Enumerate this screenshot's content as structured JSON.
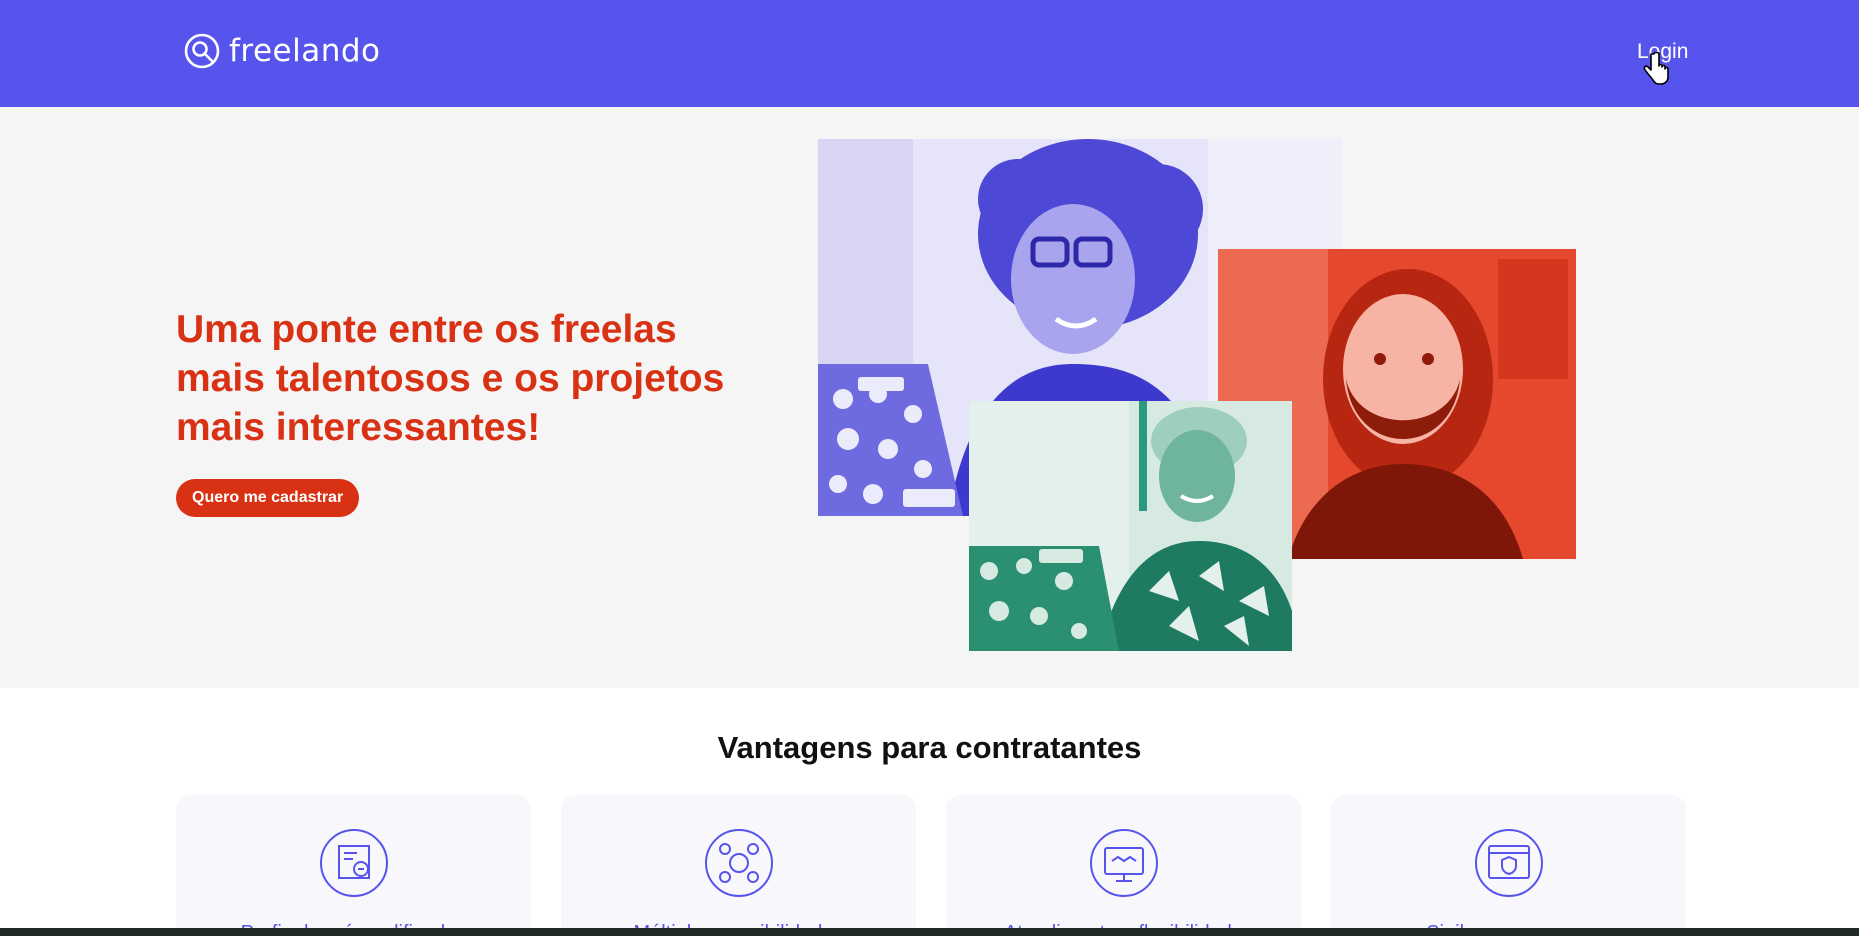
{
  "header": {
    "logo_text": "freelando",
    "login_label": "Login",
    "brand_color": "#5754ED"
  },
  "hero": {
    "title": "Uma ponte entre os freelas mais talentosos e os projetos mais interessantes!",
    "cta_label": "Quero me cadastrar",
    "accent_color": "#D93114",
    "photos": [
      {
        "name": "woman-with-laptop-photo",
        "tint": "#5754ED"
      },
      {
        "name": "bearded-man-photo",
        "tint": "#E2442A"
      },
      {
        "name": "smiling-woman-photo",
        "tint": "#2B9A7C"
      }
    ]
  },
  "advantages": {
    "title": "Vantagens para contratantes",
    "cards": [
      {
        "icon": "certificate-icon",
        "label": "Perfis de pré-qualificados"
      },
      {
        "icon": "network-people-icon",
        "label": "Múltiplas possibilidades"
      },
      {
        "icon": "handshake-monitor-icon",
        "label": "Atendimento e flexibilidade"
      },
      {
        "icon": "security-shield-window-icon",
        "label": "Sigilo e segurança"
      }
    ]
  }
}
